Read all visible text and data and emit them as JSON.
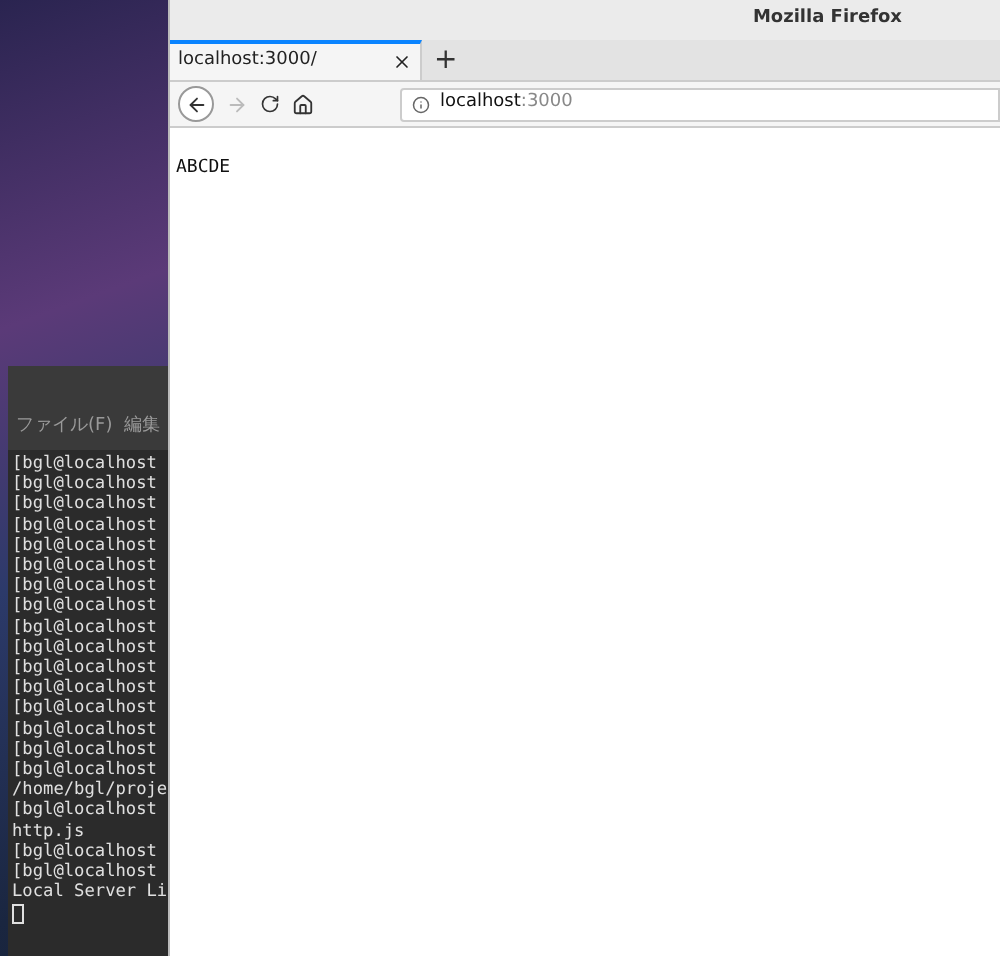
{
  "terminal": {
    "menu": [
      "ファイル(F)",
      "編集"
    ],
    "lines": [
      "[bgl@localhost",
      "[bgl@localhost",
      "[bgl@localhost",
      "[bgl@localhost",
      "[bgl@localhost",
      "[bgl@localhost",
      "[bgl@localhost",
      "[bgl@localhost",
      "[bgl@localhost",
      "[bgl@localhost",
      "[bgl@localhost",
      "[bgl@localhost",
      "[bgl@localhost",
      "[bgl@localhost",
      "[bgl@localhost",
      "[bgl@localhost",
      "/home/bgl/proje",
      "[bgl@localhost",
      "http.js",
      "[bgl@localhost",
      "[bgl@localhost",
      "Local Server Li"
    ]
  },
  "browser": {
    "title": "Mozilla Firefox",
    "tabs": [
      {
        "label": "localhost:3000/",
        "selected": true
      }
    ],
    "new_tab": "+",
    "nav": {
      "back_disabled": false,
      "forward_disabled": true
    },
    "url": {
      "host": "localhost",
      "port": ":3000"
    },
    "page_text": "ABCDE"
  }
}
